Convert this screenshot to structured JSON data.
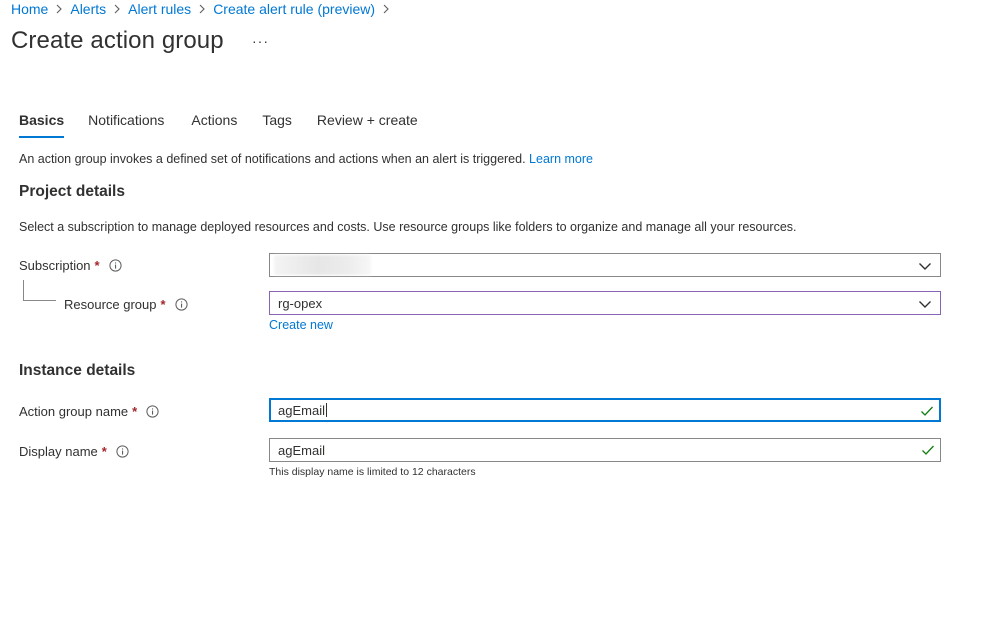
{
  "breadcrumb": {
    "items": [
      "Home",
      "Alerts",
      "Alert rules",
      "Create alert rule (preview)"
    ]
  },
  "page": {
    "title": "Create action group",
    "more": "···"
  },
  "tabs": [
    "Basics",
    "Notifications",
    "Actions",
    "Tags",
    "Review + create"
  ],
  "intro": {
    "text": "An action group invokes a defined set of notifications and actions when an alert is triggered.",
    "learn_more": "Learn more"
  },
  "project_details": {
    "title": "Project details",
    "description": "Select a subscription to manage deployed resources and costs. Use resource groups like folders to organize and manage all your resources.",
    "subscription": {
      "label": "Subscription",
      "value": ""
    },
    "resource_group": {
      "label": "Resource group",
      "value": "rg-opex",
      "create_new": "Create new"
    }
  },
  "instance_details": {
    "title": "Instance details",
    "action_group_name": {
      "label": "Action group name",
      "value": "agEmail"
    },
    "display_name": {
      "label": "Display name",
      "value": "agEmail",
      "hint": "This display name is limited to 12 characters"
    }
  },
  "required_marker": "*",
  "colors": {
    "accent": "#0078d4",
    "required": "#a4262c",
    "valid": "#107c10",
    "focus_purple": "#8764b8"
  }
}
